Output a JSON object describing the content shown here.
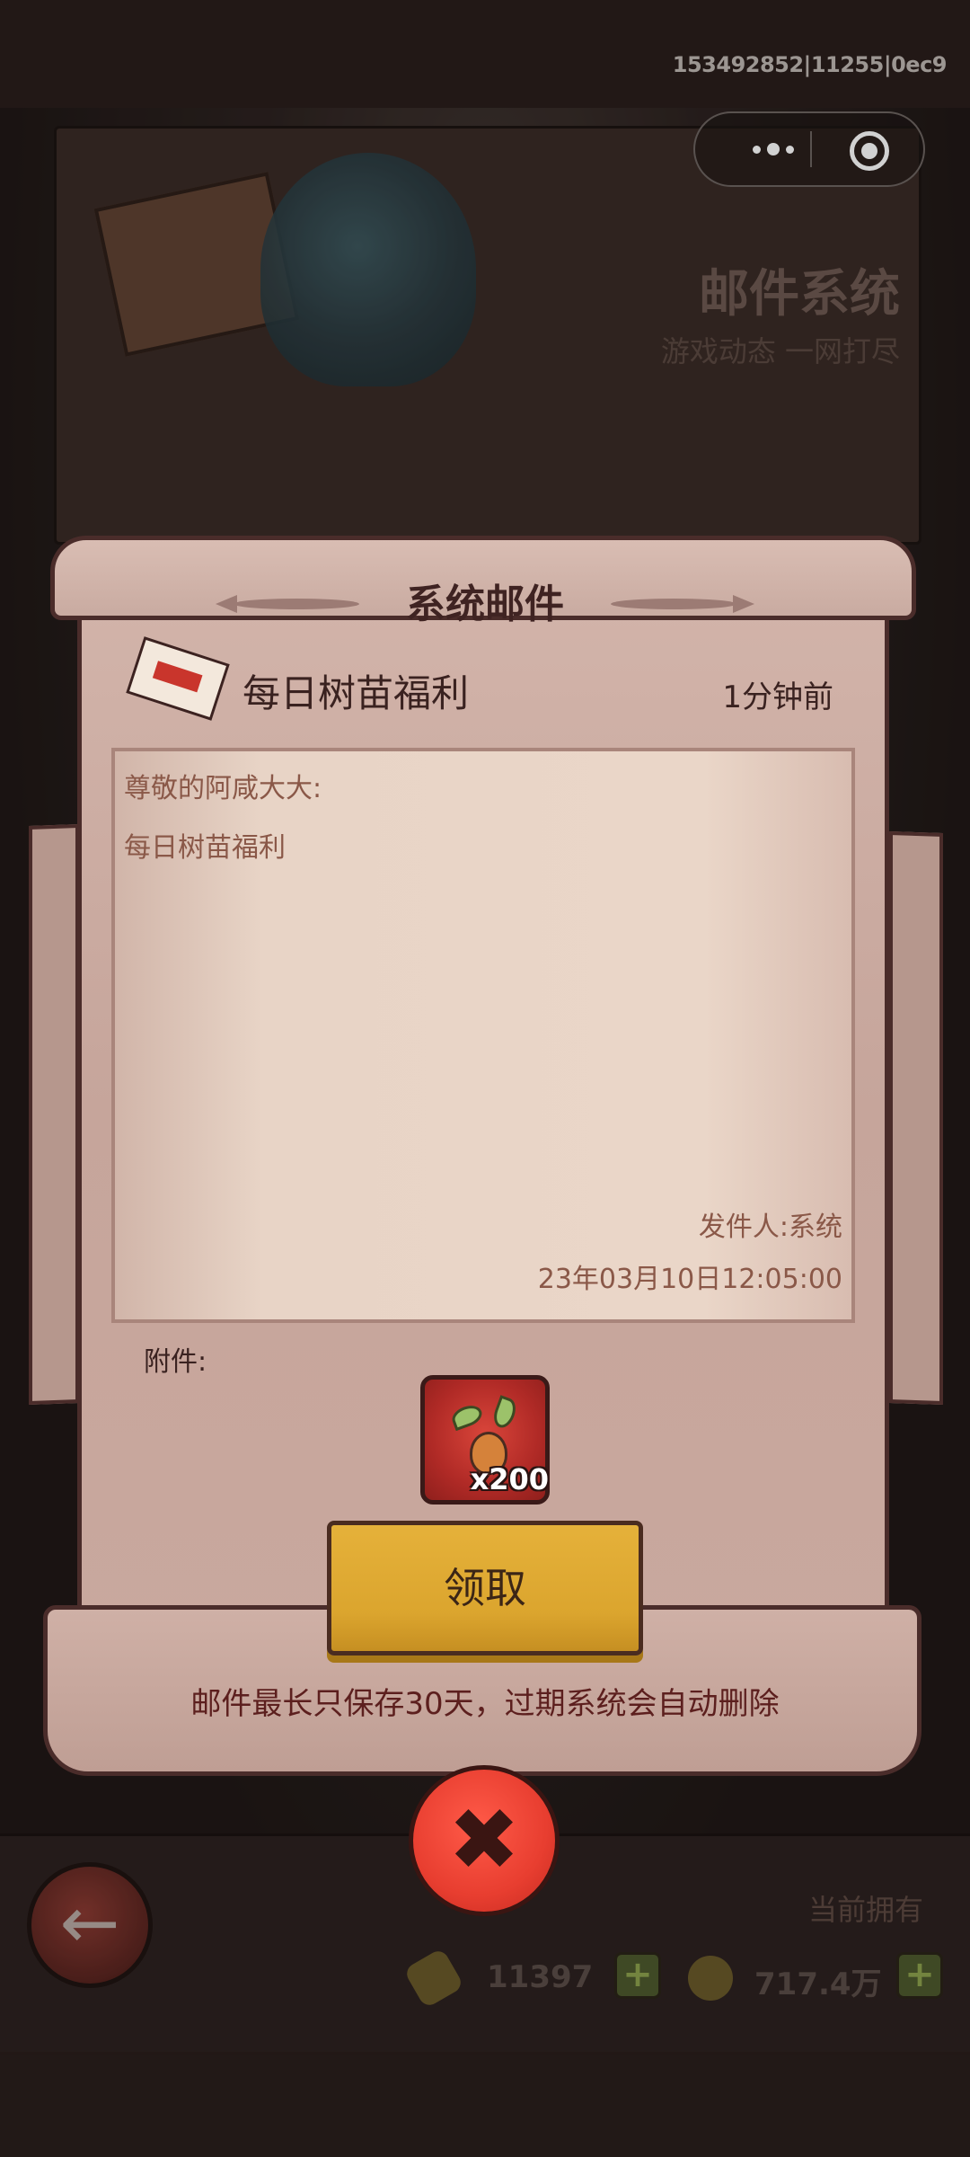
{
  "status_bar": {
    "session_id": "153492852|11255|0ec9"
  },
  "capsule": {
    "more_icon": "more-dots-icon",
    "close_icon": "target-circle-icon"
  },
  "header": {
    "title": "邮件系统",
    "subtitle": "游戏动态 一网打尽"
  },
  "dialog": {
    "title": "系统邮件",
    "subject": "每日树苗福利",
    "time_ago": "1分钟前",
    "greeting": "尊敬的阿咸大大:",
    "body": "每日树苗福利",
    "sender": "发件人:系统",
    "date": "23年03月10日12:05:00",
    "attachment_label": "附件:",
    "attachment": {
      "item": "sapling-icon",
      "count": "x200"
    },
    "claim_button": "领取",
    "notice": "邮件最长只保存30天，过期系统会自动删除"
  },
  "bottom": {
    "owned_label": "当前拥有",
    "resource_1": {
      "icon": "bone-icon",
      "value": "11397"
    },
    "resource_2": {
      "icon": "coin-icon",
      "value": "717.4万"
    }
  },
  "colors": {
    "claim": "#dba52e",
    "close": "#e83e30",
    "parchment": "#c9a89e"
  }
}
